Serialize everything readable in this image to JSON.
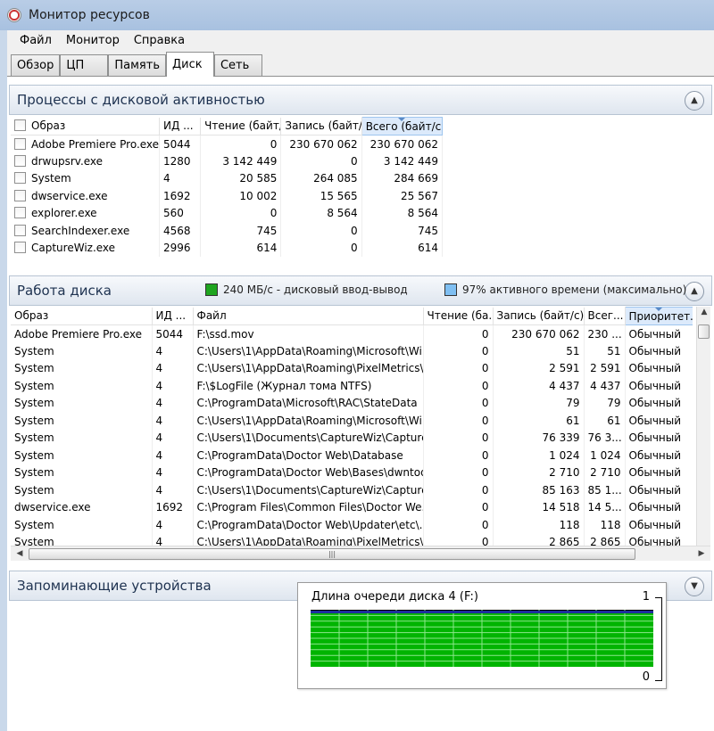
{
  "window": {
    "title": "Монитор ресурсов",
    "icon": "resource-monitor-icon"
  },
  "menu": [
    "Файл",
    "Монитор",
    "Справка"
  ],
  "tabs": [
    {
      "label": "Обзор",
      "active": false
    },
    {
      "label": "ЦП",
      "active": false
    },
    {
      "label": "Память",
      "active": false
    },
    {
      "label": "Диск",
      "active": true
    },
    {
      "label": "Сеть",
      "active": false
    }
  ],
  "processes": {
    "title": "Процессы с дисковой активностью",
    "collapse_icon": "chevron-up-icon",
    "columns": [
      "Образ",
      "ИД ...",
      "Чтение (байт/...",
      "Запись (байт/...",
      "Всего (байт/с)"
    ],
    "rows": [
      [
        "Adobe Premiere Pro.exe",
        "5044",
        "0",
        "230 670 062",
        "230 670 062"
      ],
      [
        "drwupsrv.exe",
        "1280",
        "3 142 449",
        "0",
        "3 142 449"
      ],
      [
        "System",
        "4",
        "20 585",
        "264 085",
        "284 669"
      ],
      [
        "dwservice.exe",
        "1692",
        "10 002",
        "15 565",
        "25 567"
      ],
      [
        "explorer.exe",
        "560",
        "0",
        "8 564",
        "8 564"
      ],
      [
        "SearchIndexer.exe",
        "4568",
        "745",
        "0",
        "745"
      ],
      [
        "CaptureWiz.exe",
        "2996",
        "614",
        "0",
        "614"
      ]
    ]
  },
  "disk_activity": {
    "title": "Работа диска",
    "io_label": "240 МБ/с - дисковый ввод-вывод",
    "io_color": "#1fa51f",
    "active_label": "97% активного времени (максимально)",
    "active_color": "#7fbff2",
    "collapse_icon": "chevron-up-icon",
    "columns": [
      "Образ",
      "ИД ...",
      "Файл",
      "Чтение (ба...",
      "Запись (байт/с)",
      "Всег...",
      "Приоритет..."
    ],
    "rows": [
      [
        "Adobe Premiere Pro.exe",
        "5044",
        "F:\\ssd.mov",
        "0",
        "230 670 062",
        "230 ...",
        "Обычный"
      ],
      [
        "System",
        "4",
        "C:\\Users\\1\\AppData\\Roaming\\Microsoft\\Wi...",
        "0",
        "51",
        "51",
        "Обычный"
      ],
      [
        "System",
        "4",
        "C:\\Users\\1\\AppData\\Roaming\\PixelMetrics\\...",
        "0",
        "2 591",
        "2 591",
        "Обычный"
      ],
      [
        "System",
        "4",
        "F:\\$LogFile (Журнал тома NTFS)",
        "0",
        "4 437",
        "4 437",
        "Обычный"
      ],
      [
        "System",
        "4",
        "C:\\ProgramData\\Microsoft\\RAC\\StateData",
        "0",
        "79",
        "79",
        "Обычный"
      ],
      [
        "System",
        "4",
        "C:\\Users\\1\\AppData\\Roaming\\Microsoft\\Wi...",
        "0",
        "61",
        "61",
        "Обычный"
      ],
      [
        "System",
        "4",
        "C:\\Users\\1\\Documents\\CaptureWiz\\Capture...",
        "0",
        "76 339",
        "76 3...",
        "Обычный"
      ],
      [
        "System",
        "4",
        "C:\\ProgramData\\Doctor Web\\Database",
        "0",
        "1 024",
        "1 024",
        "Обычный"
      ],
      [
        "System",
        "4",
        "C:\\ProgramData\\Doctor Web\\Bases\\dwntod...",
        "0",
        "2 710",
        "2 710",
        "Обычный"
      ],
      [
        "System",
        "4",
        "C:\\Users\\1\\Documents\\CaptureWiz\\Capture...",
        "0",
        "85 163",
        "85 1...",
        "Обычный"
      ],
      [
        "dwservice.exe",
        "1692",
        "C:\\Program Files\\Common Files\\Doctor We...",
        "0",
        "14 518",
        "14 5...",
        "Обычный"
      ],
      [
        "System",
        "4",
        "C:\\ProgramData\\Doctor Web\\Updater\\etc\\...",
        "0",
        "118",
        "118",
        "Обычный"
      ],
      [
        "System",
        "4",
        "C:\\Users\\1\\AppData\\Roaming\\PixelMetrics\\...",
        "0",
        "2 865",
        "2 865",
        "Обычный"
      ]
    ]
  },
  "storage": {
    "title": "Запоминающие устройства",
    "collapse_icon": "chevron-down-icon"
  },
  "graph": {
    "title": "Длина очереди диска 4 (F:)",
    "max_label": "1",
    "min_label": "0",
    "fill_color": "#00b400",
    "line_color": "#1f2f9e",
    "grid_color": "#8ce68c",
    "level": 0.96
  }
}
